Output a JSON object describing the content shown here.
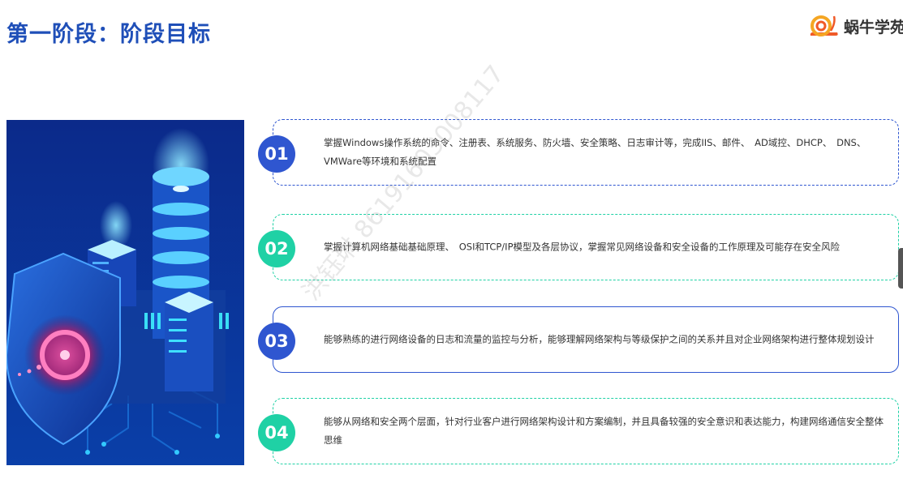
{
  "header": {
    "title": "第一阶段：阶段目标",
    "logo_text": "蜗牛学苑"
  },
  "goals": [
    {
      "number": "01",
      "color": "#2f56d0",
      "text": "掌握Windows操作系统的命令、注册表、系统服务、防火墙、安全策略、日志审计等，完成IIS、邮件、　AD域控、DHCP、　DNS、VMWare等环境和系统配置"
    },
    {
      "number": "02",
      "color": "#1fd1a5",
      "text": "掌握计算机网络基础基础原理、　OSI和TCP/IP模型及各层协议，掌握常见网络设备和安全设备的工作原理及可能存在安全风险"
    },
    {
      "number": "03",
      "color": "#2f56d0",
      "text": "能够熟练的进行网络设备的日志和流量的监控与分析，能够理解网络架构与等级保护之间的关系并且对企业网络架构进行整体规划设计"
    },
    {
      "number": "04",
      "color": "#1fd1a5",
      "text": "能够从网络和安全两个层面，针对行业客户进行网络架构设计和方案编制，并且具备较强的安全意识和表达能力，构建网络通信安全整体思维"
    }
  ],
  "watermark": "洪钰琳 86191603008117"
}
